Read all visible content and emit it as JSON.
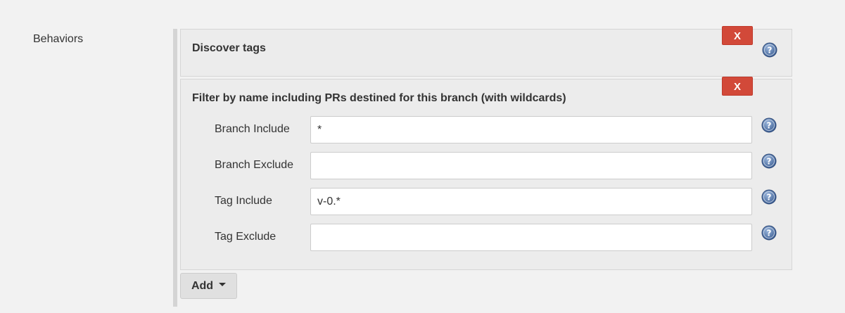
{
  "section": {
    "label": "Behaviors"
  },
  "behaviors": [
    {
      "title": "Discover tags",
      "delete_label": "X",
      "help_icon": "help-question-icon"
    },
    {
      "title": "Filter by name including PRs destined for this branch (with wildcards)",
      "delete_label": "X",
      "fields": [
        {
          "label": "Branch Include",
          "value": "*"
        },
        {
          "label": "Branch Exclude",
          "value": ""
        },
        {
          "label": "Tag Include",
          "value": "v-0.*"
        },
        {
          "label": "Tag Exclude",
          "value": ""
        }
      ]
    }
  ],
  "add_button": {
    "label": "Add",
    "icon": "caret-down-icon"
  },
  "colors": {
    "background": "#f2f2f2",
    "panel": "#ececec",
    "delete": "#d24939",
    "help": "#4a6fa5"
  }
}
